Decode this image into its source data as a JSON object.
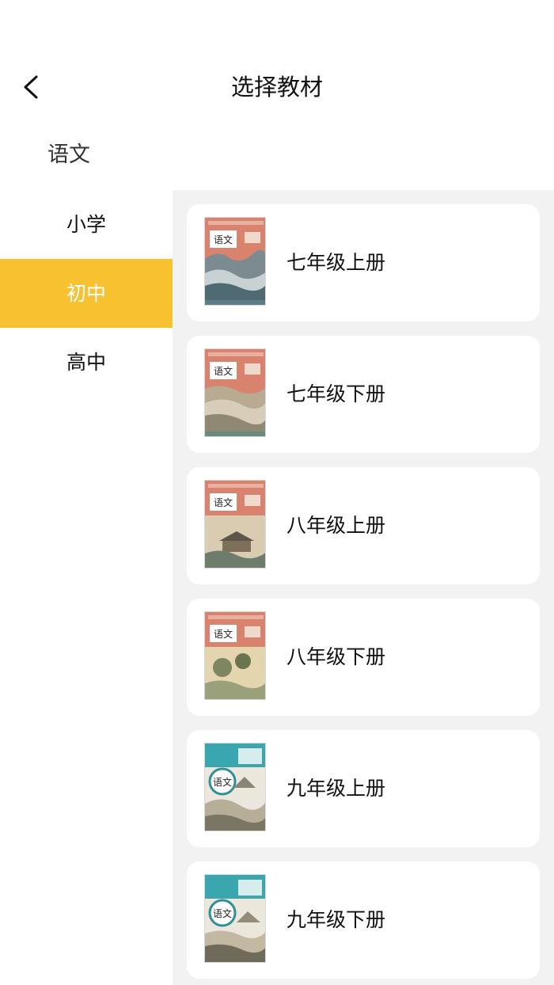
{
  "header": {
    "title": "选择教材",
    "back_icon": "chevron-left-icon"
  },
  "subject": "语文",
  "sidebar": {
    "items": [
      {
        "label": "小学",
        "active": false
      },
      {
        "label": "初中",
        "active": true
      },
      {
        "label": "高中",
        "active": false
      }
    ]
  },
  "books": [
    {
      "label": "七年级上册",
      "cover_label": "语文"
    },
    {
      "label": "七年级下册",
      "cover_label": "语文"
    },
    {
      "label": "八年级上册",
      "cover_label": "语文"
    },
    {
      "label": "八年级下册",
      "cover_label": "语文"
    },
    {
      "label": "九年级上册",
      "cover_label": "语文"
    },
    {
      "label": "九年级下册",
      "cover_label": "语文"
    }
  ],
  "colors": {
    "accent": "#f7c12f",
    "panel_bg": "#f2f2f2",
    "cover_red": "#d9826e",
    "cover_teal": "#3aa6ad"
  }
}
